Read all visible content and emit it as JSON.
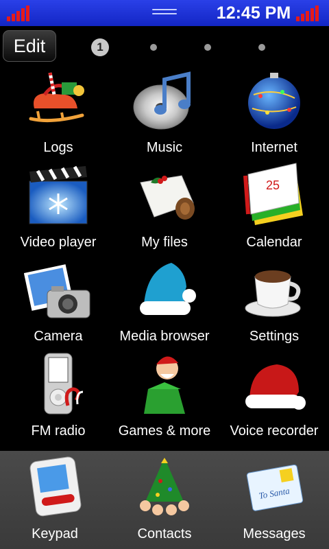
{
  "status": {
    "time": "12:45 PM"
  },
  "edit_label": "Edit",
  "pager": {
    "current": "1"
  },
  "apps": [
    {
      "label": "Logs",
      "icon": "sleigh-icon"
    },
    {
      "label": "Music",
      "icon": "music-cd-icon"
    },
    {
      "label": "Internet",
      "icon": "globe-ornament-icon"
    },
    {
      "label": "Video player",
      "icon": "clapperboard-icon"
    },
    {
      "label": "My files",
      "icon": "yule-log-cake-icon"
    },
    {
      "label": "Calendar",
      "icon": "calendar-icon"
    },
    {
      "label": "Camera",
      "icon": "camera-icon"
    },
    {
      "label": "Media browser",
      "icon": "blue-santa-hat-icon"
    },
    {
      "label": "Settings",
      "icon": "coffee-cup-icon"
    },
    {
      "label": "FM radio",
      "icon": "music-player-icon"
    },
    {
      "label": "Games & more",
      "icon": "jack-in-the-box-icon"
    },
    {
      "label": "Voice recorder",
      "icon": "red-santa-hat-icon"
    }
  ],
  "dock": [
    {
      "label": "Keypad",
      "icon": "keypad-icon"
    },
    {
      "label": "Contacts",
      "icon": "christmas-tree-icon"
    },
    {
      "label": "Messages",
      "icon": "letter-to-santa-icon",
      "icon_text": "To Santa"
    }
  ]
}
